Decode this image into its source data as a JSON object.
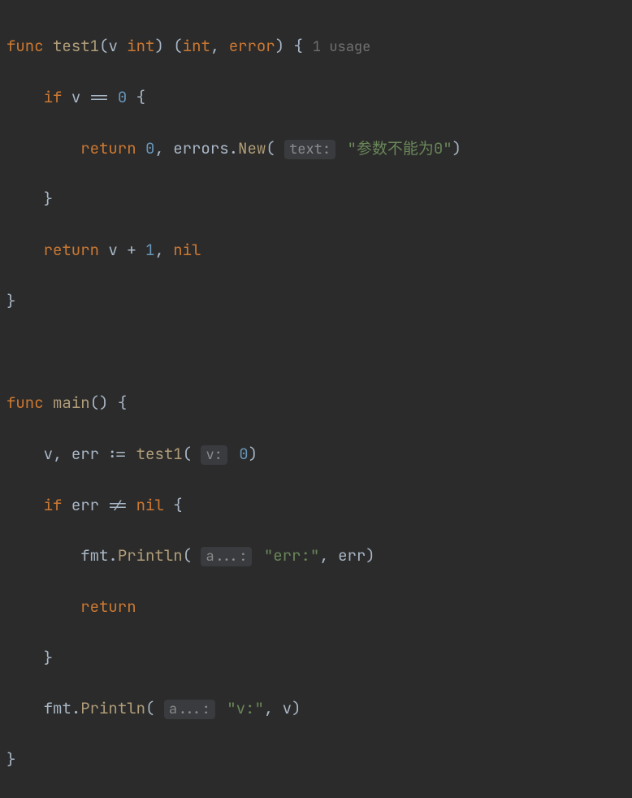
{
  "func1": {
    "keyword_func": "func",
    "name": "test1",
    "param_name": "v",
    "param_type": "int",
    "ret_type1": "int",
    "ret_type2": "error",
    "usage": "1 usage",
    "if_kw": "if",
    "cond_var": "v",
    "cond_op": "==",
    "cond_val": "0",
    "return_kw": "return",
    "ret_val1": "0",
    "errors_pkg": "errors",
    "new_method": "New",
    "hint_text": "text:",
    "err_string": "\"参数不能为0\"",
    "return2_kw": "return",
    "ret2_expr_v": "v",
    "ret2_op": "+",
    "ret2_val": "1",
    "ret2_nil": "nil"
  },
  "func2": {
    "keyword_func": "func",
    "name": "main",
    "var_v": "v",
    "var_err": "err",
    "assign_op": ":=",
    "call_fn": "test1",
    "hint_v": "v:",
    "arg_val": "0",
    "if_kw": "if",
    "cond_var": "err",
    "cond_op": "!=",
    "cond_nil": "nil",
    "fmt_pkg": "fmt",
    "println_method": "Println",
    "hint_a": "a...:",
    "err_label": "\"err:\"",
    "err_var": "err",
    "return_kw": "return",
    "fmt_pkg2": "fmt",
    "println_method2": "Println",
    "hint_a2": "a...:",
    "v_label": "\"v:\"",
    "v_var": "v"
  }
}
